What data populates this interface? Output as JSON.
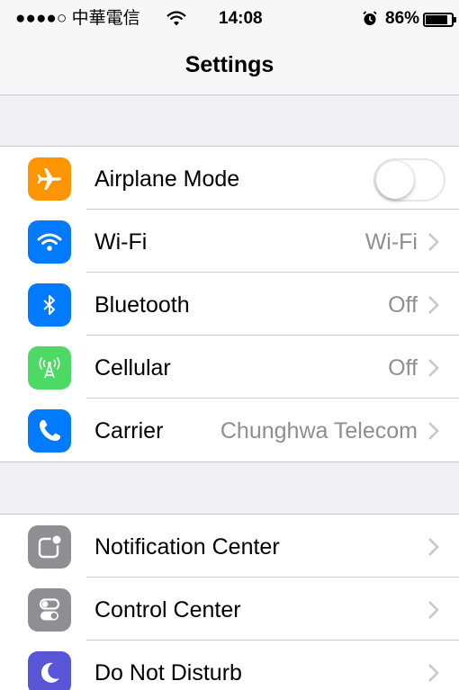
{
  "status_bar": {
    "carrier": "●●●●○ 中華電信",
    "time": "14:08",
    "battery_percent": "86%",
    "battery_level": 0.86,
    "icons": [
      "wifi-icon",
      "alarm-icon",
      "battery-icon"
    ]
  },
  "nav": {
    "title": "Settings"
  },
  "colors": {
    "airplane": "#ff9500",
    "wifi": "#007aff",
    "bluetooth": "#007aff",
    "cellular": "#4cd964",
    "carrier": "#007aff",
    "notification_center": "#8e8e93",
    "control_center": "#8e8e93",
    "do_not_disturb": "#5856d6"
  },
  "settings": {
    "group1": [
      {
        "label": "Airplane Mode",
        "icon": "airplane-icon",
        "control": "toggle",
        "toggle_on": false
      },
      {
        "label": "Wi-Fi",
        "icon": "wifi-icon",
        "value": "Wi-Fi"
      },
      {
        "label": "Bluetooth",
        "icon": "bluetooth-icon",
        "value": "Off"
      },
      {
        "label": "Cellular",
        "icon": "cellular-icon",
        "value": "Off"
      },
      {
        "label": "Carrier",
        "icon": "phone-icon",
        "value": "Chunghwa Telecom"
      }
    ],
    "group2": [
      {
        "label": "Notification Center",
        "icon": "notification-center-icon"
      },
      {
        "label": "Control Center",
        "icon": "control-center-icon"
      },
      {
        "label": "Do Not Disturb",
        "icon": "moon-icon"
      }
    ]
  }
}
